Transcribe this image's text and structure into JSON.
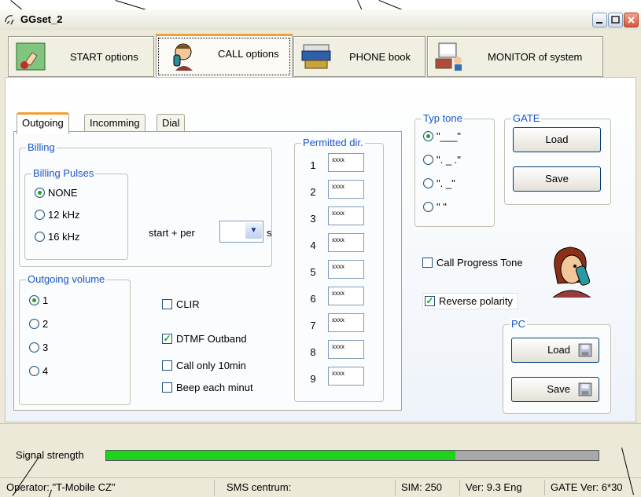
{
  "window": {
    "title": "GGset_2"
  },
  "toolbar": {
    "buttons": [
      {
        "label": "START options",
        "icon": "hand-pointer-icon"
      },
      {
        "label": "CALL options",
        "icon": "person-phone-icon",
        "active": true
      },
      {
        "label": "PHONE book",
        "icon": "phone-book-icon"
      },
      {
        "label": "MONITOR of system",
        "icon": "computer-monitor-icon"
      }
    ]
  },
  "tabs": [
    "Outgoing",
    "Incomming",
    "Dial"
  ],
  "billing": {
    "legend": "Billing",
    "pulses_legend": "Billing Pulses",
    "options": [
      "NONE",
      "12 kHz",
      "16 kHz"
    ],
    "selected": "NONE",
    "start_per_label": "start + per",
    "start_per_unit": "s"
  },
  "outgoing_volume": {
    "legend": "Outgoing volume",
    "options": [
      "1",
      "2",
      "3",
      "4"
    ],
    "selected": "1"
  },
  "checks": {
    "clir": {
      "label": "CLIR",
      "checked": false
    },
    "dtmf": {
      "label": "DTMF Outband",
      "checked": true
    },
    "call10": {
      "label": "Call only 10min",
      "checked": false
    },
    "beep": {
      "label": "Beep each minut",
      "checked": false
    }
  },
  "permitted": {
    "legend": "Permitted dir.",
    "rows": [
      {
        "n": "1",
        "v": "xxxx"
      },
      {
        "n": "2",
        "v": "xxxx"
      },
      {
        "n": "3",
        "v": "xxxx"
      },
      {
        "n": "4",
        "v": "xxxx"
      },
      {
        "n": "5",
        "v": "xxxx"
      },
      {
        "n": "6",
        "v": "xxxx"
      },
      {
        "n": "7",
        "v": "xxxx"
      },
      {
        "n": "8",
        "v": "xxxx"
      },
      {
        "n": "9",
        "v": "xxxx"
      }
    ]
  },
  "typ_tone": {
    "legend": "Typ tone",
    "options": [
      "\"___\"",
      "\". _ .\"",
      "\". _\"",
      "\"   \""
    ],
    "selected": 0
  },
  "gate": {
    "legend": "GATE",
    "load": "Load",
    "save": "Save"
  },
  "right_checks": {
    "cpt": {
      "label": "Call Progress Tone",
      "checked": false
    },
    "rev": {
      "label": "Reverse polarity",
      "checked": true
    }
  },
  "pc": {
    "legend": "PC",
    "load": "Load",
    "save": "Save"
  },
  "signal": {
    "label": "Signal strength",
    "level_percent": 71,
    "color": "#1ed21e"
  },
  "status": {
    "operator": "Operator: \"T-Mobile CZ\"",
    "sms": "SMS centrum:",
    "sim": "SIM: 250",
    "ver": "Ver: 9.3 Eng",
    "gate_ver": "GATE Ver: 6*30"
  }
}
